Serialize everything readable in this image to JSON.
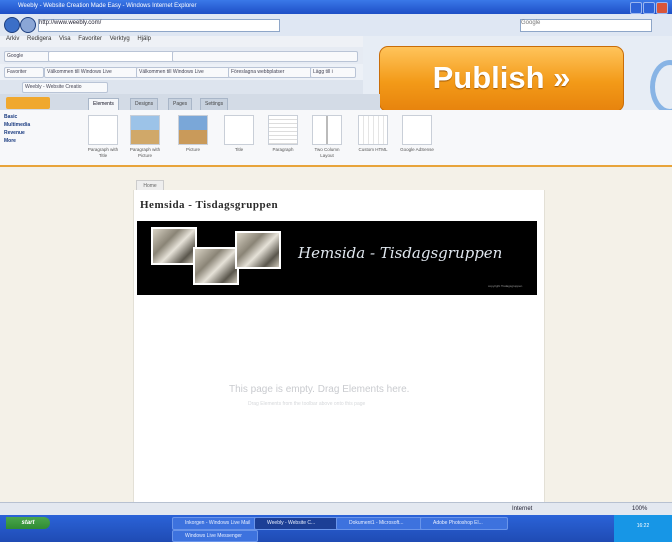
{
  "window": {
    "title": "Weebly - Website Creation Made Easy - Windows Internet Explorer"
  },
  "browser": {
    "address": "http://www.weebly.com/",
    "search_placeholder": "Google",
    "menu": [
      "Arkiv",
      "Redigera",
      "Visa",
      "Favoriter",
      "Verktyg",
      "Hjälp"
    ],
    "toolbar_search_label": "Google",
    "favorites_label": "Favoriter",
    "favorites": [
      "Välkommen till Windows Live",
      "Välkommen till Windows Live",
      "Föreslagna webbplatser",
      "Lägg till i"
    ],
    "tab_label": "Weebly - Website Creatio"
  },
  "publish_button": "Publish »",
  "weebly": {
    "tabs": [
      "Elements",
      "Designs",
      "Pages",
      "Settings"
    ],
    "active_tab": "Elements",
    "sidebar": [
      "Basic",
      "Multimedia",
      "Revenue",
      "More"
    ],
    "elements": [
      {
        "label": "Paragraph with Title"
      },
      {
        "label": "Paragraph with Picture"
      },
      {
        "label": "Picture"
      },
      {
        "label": "Title"
      },
      {
        "label": "Paragraph"
      },
      {
        "label": "Two Column Layout"
      },
      {
        "label": "Custom HTML"
      },
      {
        "label": "Google AdSense"
      }
    ]
  },
  "page": {
    "tab": "Home",
    "heading": "Hemsida - Tisdagsgruppen",
    "banner_title": "Hemsida - Tisdagsgruppen",
    "banner_small": "copyright Tisdagsgruppen",
    "empty_main": "This page is empty. Drag Elements here.",
    "empty_sub": "Drag Elements from the toolbar above onto this page"
  },
  "status": {
    "zone": "Internet",
    "zoom": "100%"
  },
  "taskbar": {
    "start": "start",
    "tasks": [
      "Inkorgen - Windows Live Mail",
      "Weebly - Website C...",
      "Dokument1 - Microsoft...",
      "Adobe Photoshop El..."
    ],
    "tasks_row2": [
      "Windows Live Messenger"
    ],
    "clock": "16:22"
  }
}
